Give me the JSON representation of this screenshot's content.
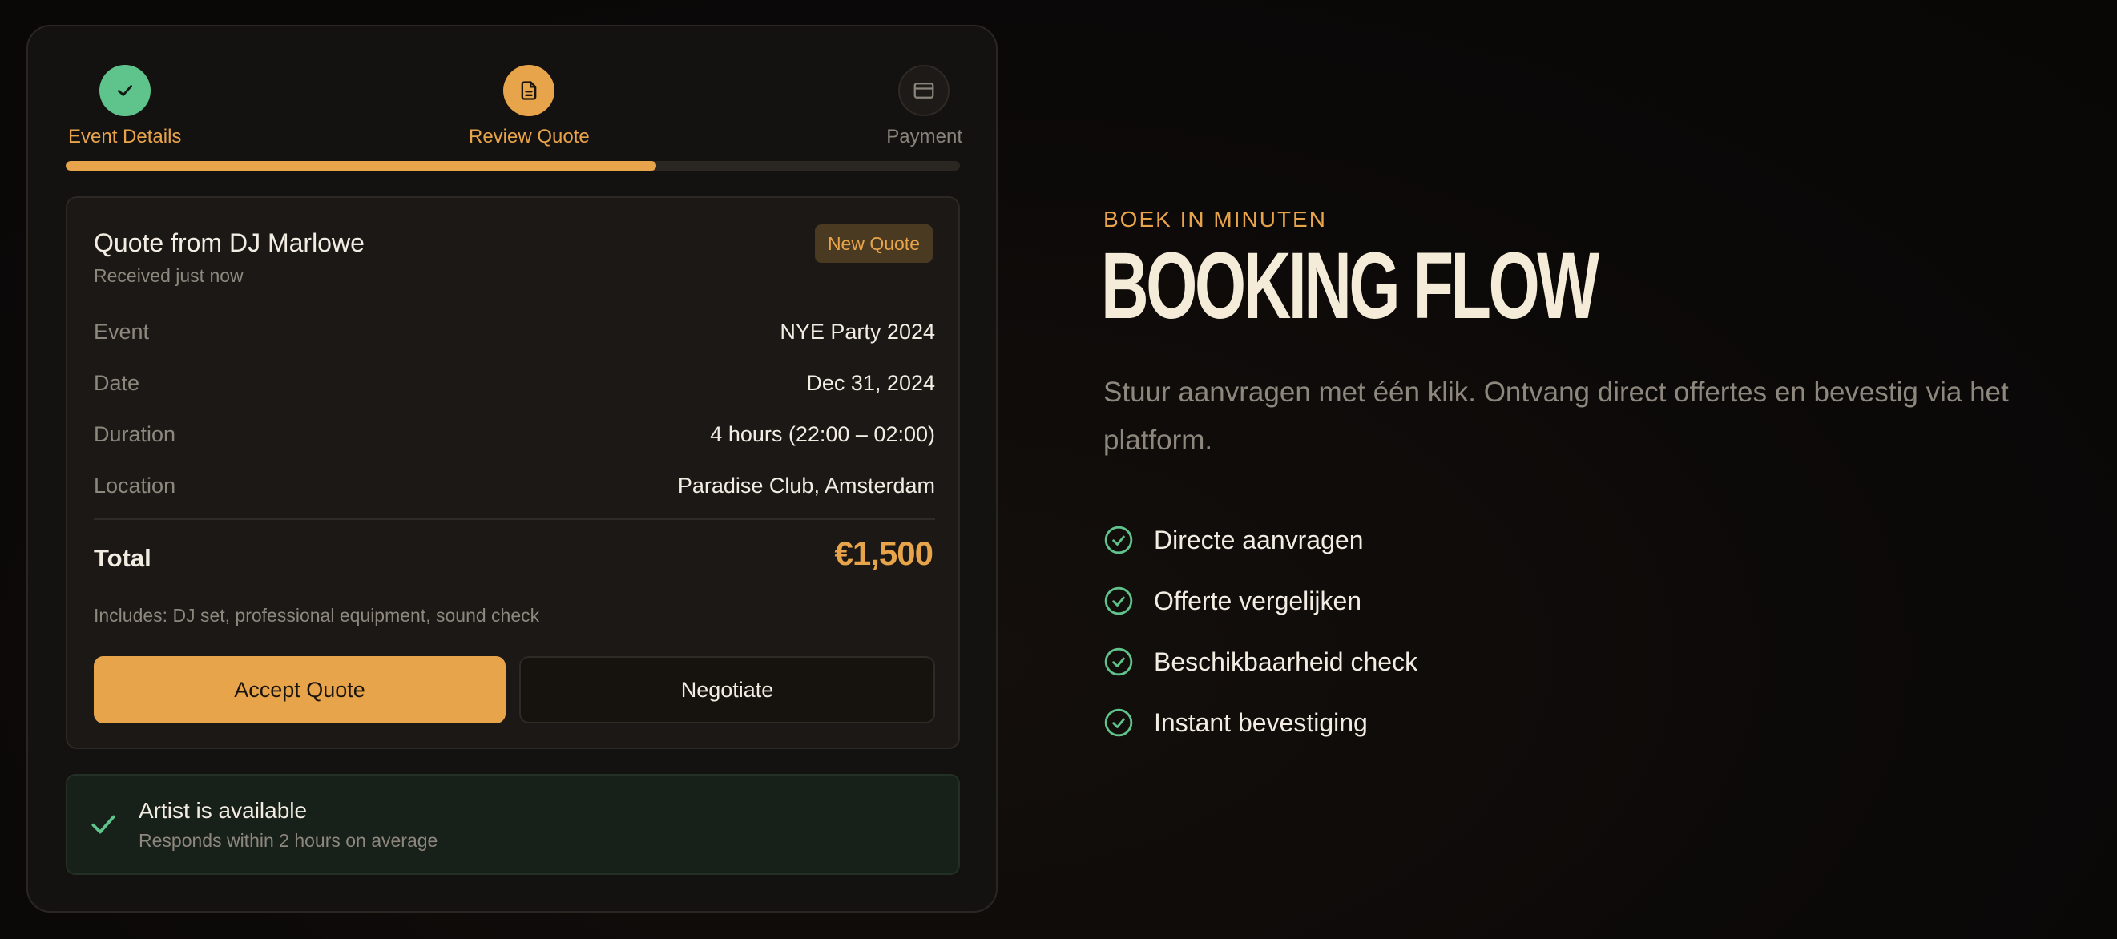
{
  "steps": [
    {
      "label": "Event Details",
      "state": "done",
      "icon": "check-icon"
    },
    {
      "label": "Review Quote",
      "state": "active",
      "icon": "document-icon"
    },
    {
      "label": "Payment",
      "state": "pending",
      "icon": "credit-card-icon"
    }
  ],
  "progress": {
    "percent": 66
  },
  "quote": {
    "title": "Quote from DJ Marlowe",
    "received": "Received just now",
    "badge": "New Quote",
    "rows": [
      {
        "key": "Event",
        "value": "NYE Party 2024"
      },
      {
        "key": "Date",
        "value": "Dec 31, 2024"
      },
      {
        "key": "Duration",
        "value": "4 hours (22:00 – 02:00)"
      },
      {
        "key": "Location",
        "value": "Paradise Club, Amsterdam"
      }
    ],
    "total_label": "Total",
    "total_value": "€1,500",
    "includes": "Includes: DJ set, professional equipment, sound check",
    "accept_label": "Accept Quote",
    "negotiate_label": "Negotiate"
  },
  "availability": {
    "title": "Artist is available",
    "subtitle": "Responds within 2 hours on average"
  },
  "hero": {
    "eyebrow": "BOEK IN MINUTEN",
    "heading": "BOOKING FLOW",
    "lead": "Stuur aanvragen met één klik. Ontvang direct offertes en bevestig via het platform.",
    "features": [
      "Directe aanvragen",
      "Offerte vergelijken",
      "Beschikbaarheid check",
      "Instant bevestiging"
    ]
  },
  "colors": {
    "accent": "#e8a44a",
    "success": "#5fc48c",
    "background": "#0b0908",
    "card": "#1b1815"
  }
}
